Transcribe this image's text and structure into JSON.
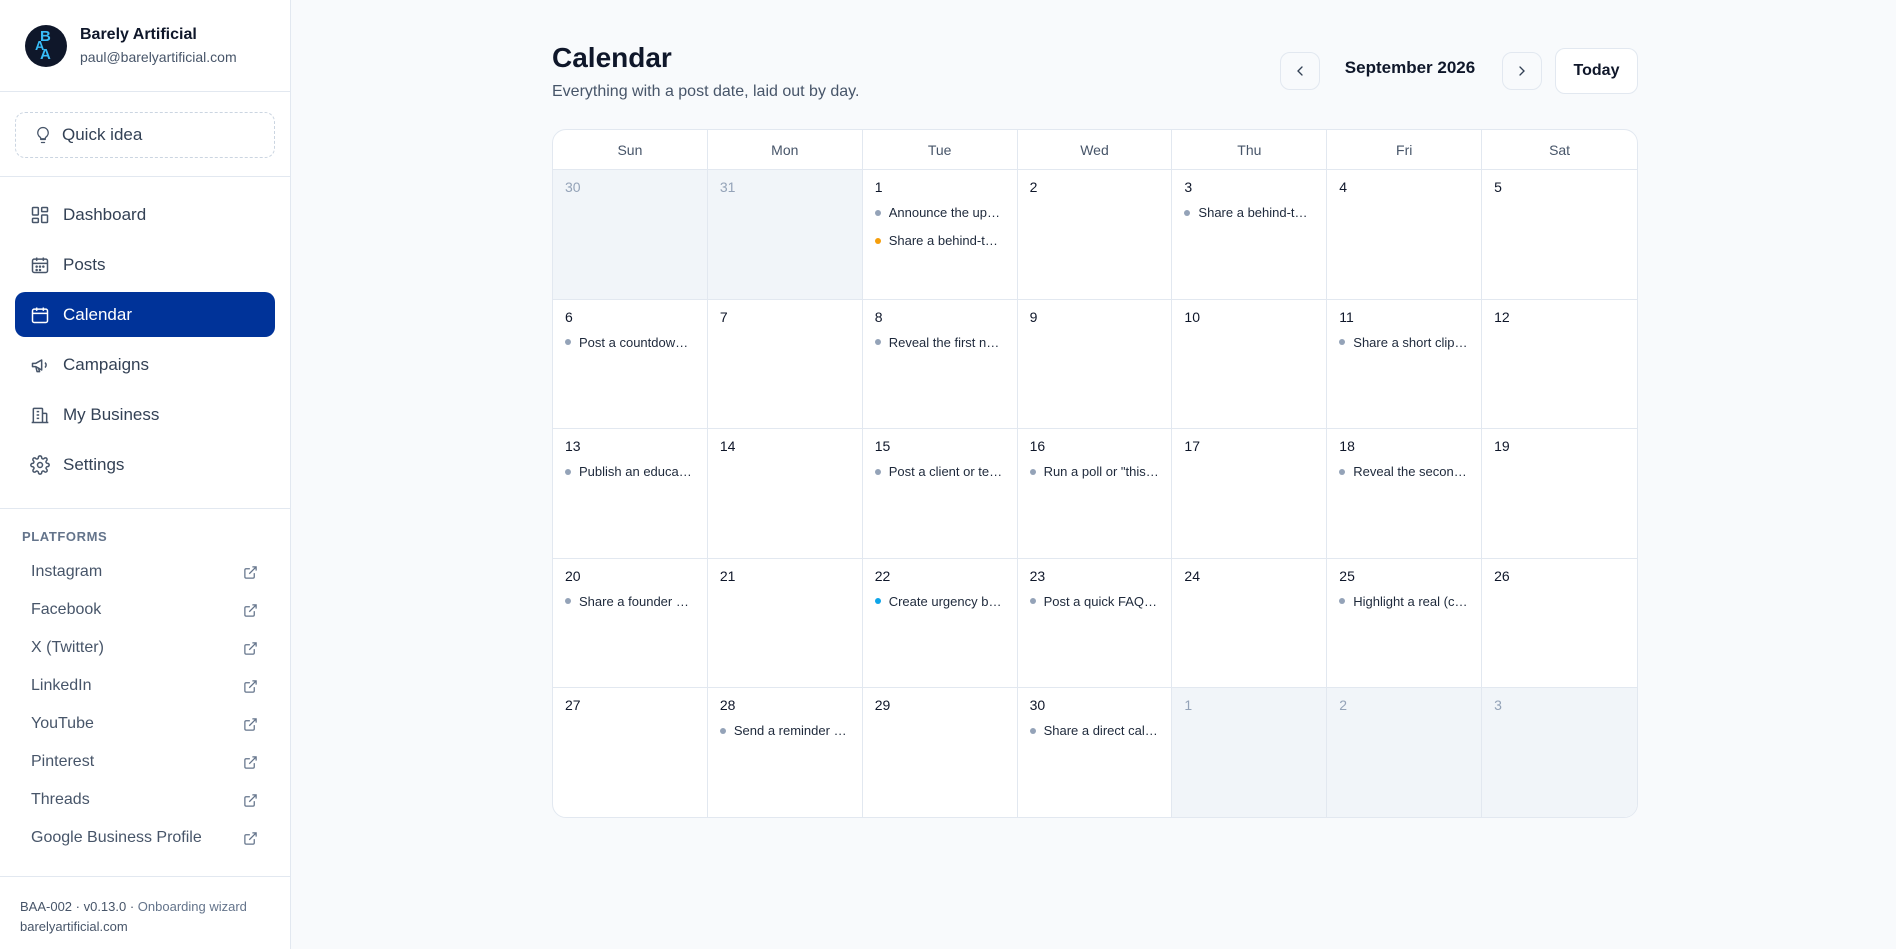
{
  "profile": {
    "initials": [
      "B",
      "A",
      "A"
    ],
    "name": "Barely Artificial",
    "email": "paul@barelyartificial.com"
  },
  "quick_idea": {
    "label": "Quick idea",
    "icon": "lightbulb-icon"
  },
  "nav": [
    {
      "label": "Dashboard",
      "icon": "dashboard-icon",
      "active": false
    },
    {
      "label": "Posts",
      "icon": "posts-calendar-icon",
      "active": false
    },
    {
      "label": "Calendar",
      "icon": "calendar-icon",
      "active": true
    },
    {
      "label": "Campaigns",
      "icon": "megaphone-icon",
      "active": false
    },
    {
      "label": "My Business",
      "icon": "building-icon",
      "active": false
    },
    {
      "label": "Settings",
      "icon": "gear-icon",
      "active": false
    }
  ],
  "platforms": {
    "title": "PLATFORMS",
    "items": [
      "Instagram",
      "Facebook",
      "X (Twitter)",
      "LinkedIn",
      "YouTube",
      "Pinterest",
      "Threads",
      "Google Business Profile"
    ]
  },
  "footer": {
    "version": "BAA-002 · v0.13.0 ·",
    "mode": "Onboarding wizard",
    "domain": "barelyartificial.com"
  },
  "header": {
    "title": "Calendar",
    "subtitle": "Everything with a post date, laid out by day."
  },
  "month": {
    "label": "September 2026",
    "today_label": "Today"
  },
  "colors": {
    "accent": "#003399",
    "dot_default": "#94a3b8",
    "dot_orange": "#f59e0b",
    "dot_blue": "#0ea5e9"
  },
  "weekdays": [
    "Sun",
    "Mon",
    "Tue",
    "Wed",
    "Thu",
    "Fri",
    "Sat"
  ],
  "days": [
    {
      "day": "30",
      "out": true,
      "events": []
    },
    {
      "day": "31",
      "out": true,
      "events": []
    },
    {
      "day": "1",
      "out": false,
      "events": [
        {
          "text": "Announce the upcoming launch",
          "color": "#94a3b8"
        },
        {
          "text": "Share a behind-the-scenes look",
          "color": "#f59e0b"
        }
      ]
    },
    {
      "day": "2",
      "out": false,
      "events": []
    },
    {
      "day": "3",
      "out": false,
      "events": [
        {
          "text": "Share a behind-the-scenes photo",
          "color": "#94a3b8"
        }
      ]
    },
    {
      "day": "4",
      "out": false,
      "events": []
    },
    {
      "day": "5",
      "out": false,
      "events": []
    },
    {
      "day": "6",
      "out": false,
      "events": [
        {
          "text": "Post a countdown to launch",
          "color": "#94a3b8"
        }
      ]
    },
    {
      "day": "7",
      "out": false,
      "events": []
    },
    {
      "day": "8",
      "out": false,
      "events": [
        {
          "text": "Reveal the first new feature",
          "color": "#94a3b8"
        }
      ]
    },
    {
      "day": "9",
      "out": false,
      "events": []
    },
    {
      "day": "10",
      "out": false,
      "events": []
    },
    {
      "day": "11",
      "out": false,
      "events": [
        {
          "text": "Share a short clip of the product",
          "color": "#94a3b8"
        }
      ]
    },
    {
      "day": "12",
      "out": false,
      "events": []
    },
    {
      "day": "13",
      "out": false,
      "events": [
        {
          "text": "Publish an educational post",
          "color": "#94a3b8"
        }
      ]
    },
    {
      "day": "14",
      "out": false,
      "events": []
    },
    {
      "day": "15",
      "out": false,
      "events": [
        {
          "text": "Post a client or team spotlight",
          "color": "#94a3b8"
        }
      ]
    },
    {
      "day": "16",
      "out": false,
      "events": [
        {
          "text": "Run a poll or \"this or that\"",
          "color": "#94a3b8"
        }
      ]
    },
    {
      "day": "17",
      "out": false,
      "events": []
    },
    {
      "day": "18",
      "out": false,
      "events": [
        {
          "text": "Reveal the second feature",
          "color": "#94a3b8"
        }
      ]
    },
    {
      "day": "19",
      "out": false,
      "events": []
    },
    {
      "day": "20",
      "out": false,
      "events": [
        {
          "text": "Share a founder story",
          "color": "#94a3b8"
        }
      ]
    },
    {
      "day": "21",
      "out": false,
      "events": []
    },
    {
      "day": "22",
      "out": false,
      "events": [
        {
          "text": "Create urgency before launch",
          "color": "#0ea5e9"
        }
      ]
    },
    {
      "day": "23",
      "out": false,
      "events": [
        {
          "text": "Post a quick FAQ answer",
          "color": "#94a3b8"
        }
      ]
    },
    {
      "day": "24",
      "out": false,
      "events": []
    },
    {
      "day": "25",
      "out": false,
      "events": [
        {
          "text": "Highlight a real (customer) review",
          "color": "#94a3b8"
        }
      ]
    },
    {
      "day": "26",
      "out": false,
      "events": []
    },
    {
      "day": "27",
      "out": false,
      "events": []
    },
    {
      "day": "28",
      "out": false,
      "events": [
        {
          "text": "Send a reminder to followers",
          "color": "#94a3b8"
        }
      ]
    },
    {
      "day": "29",
      "out": false,
      "events": []
    },
    {
      "day": "30",
      "out": false,
      "events": [
        {
          "text": "Share a direct call to action",
          "color": "#94a3b8"
        }
      ]
    },
    {
      "day": "1",
      "out": true,
      "events": []
    },
    {
      "day": "2",
      "out": true,
      "events": []
    },
    {
      "day": "3",
      "out": true,
      "events": []
    }
  ]
}
